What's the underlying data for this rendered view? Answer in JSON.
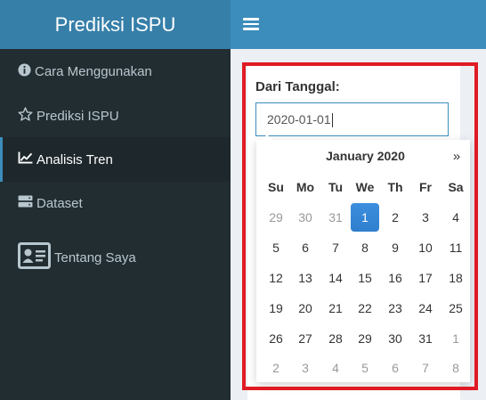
{
  "header": {
    "brand": "Prediksi ISPU"
  },
  "sidebar": {
    "items": [
      {
        "label": "Cara Menggunakan",
        "icon": "info-circle-icon"
      },
      {
        "label": "Prediksi ISPU",
        "icon": "star-outline-icon"
      },
      {
        "label": "Analisis Tren",
        "icon": "line-chart-icon",
        "active": true
      },
      {
        "label": "Dataset",
        "icon": "server-icon"
      },
      {
        "label": "Tentang Saya",
        "icon": "id-card-icon"
      }
    ]
  },
  "form": {
    "label": "Dari Tanggal:",
    "value": "2020-01-01"
  },
  "datepicker": {
    "title": "January 2020",
    "next": "»",
    "weekdays": [
      "Su",
      "Mo",
      "Tu",
      "We",
      "Th",
      "Fr",
      "Sa"
    ],
    "weeks": [
      [
        "29",
        "30",
        "31",
        "1",
        "2",
        "3",
        "4"
      ],
      [
        "5",
        "6",
        "7",
        "8",
        "9",
        "10",
        "11"
      ],
      [
        "12",
        "13",
        "14",
        "15",
        "16",
        "17",
        "18"
      ],
      [
        "19",
        "20",
        "21",
        "22",
        "23",
        "24",
        "25"
      ],
      [
        "26",
        "27",
        "28",
        "29",
        "30",
        "31",
        "1"
      ],
      [
        "2",
        "3",
        "4",
        "5",
        "6",
        "7",
        "8"
      ]
    ],
    "selected": "1",
    "colors": {
      "selected": "#337ab7",
      "muted": "#999999",
      "highlight_border": "#e01b24"
    }
  }
}
